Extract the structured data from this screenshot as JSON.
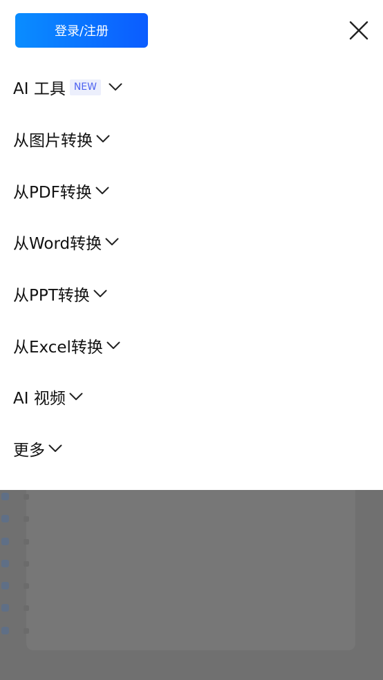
{
  "header": {
    "login_label": "登录/注册"
  },
  "menu": {
    "items": [
      {
        "label": "AI 工具",
        "badge": "NEW"
      },
      {
        "label": "从图片转换"
      },
      {
        "label": "从PDF转换"
      },
      {
        "label": "从Word转换"
      },
      {
        "label": "从PPT转换"
      },
      {
        "label": "从Excel转换"
      },
      {
        "label": "AI 视频"
      },
      {
        "label": "更多"
      }
    ]
  },
  "icons": {
    "close": "close-icon",
    "expand": "chevron-down-icon"
  },
  "colors": {
    "primary_gradient_start": "#0a8dff",
    "primary_gradient_end": "#0b5cff",
    "badge_text": "#4d63f0",
    "badge_bg": "#eceffc",
    "overlay": "#707070"
  }
}
